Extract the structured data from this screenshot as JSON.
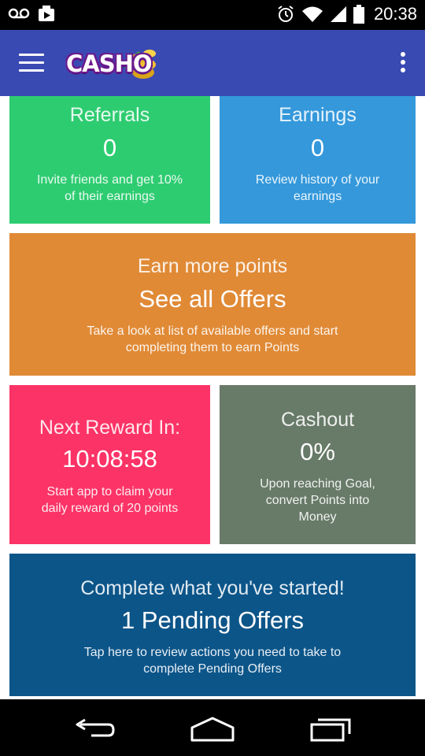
{
  "status_bar": {
    "time": "20:38",
    "left_icons": [
      "voicemail-icon",
      "media-icon"
    ],
    "right_icons": [
      "alarm-icon",
      "wifi-icon",
      "signal-icon",
      "battery-icon"
    ]
  },
  "app_bar": {
    "logo_text": "CASHO",
    "background": "#3a4ab3",
    "icons": [
      "menu-icon",
      "overflow-menu-icon"
    ]
  },
  "tiles": {
    "referrals": {
      "title": "Referrals",
      "value": "0",
      "description_line1": "Invite friends and get 10%",
      "description_line2": "of their earnings",
      "color": "#2ecc71"
    },
    "earnings": {
      "title": "Earnings",
      "value": "0",
      "description_line1": "Review history of your",
      "description_line2": "earnings",
      "color": "#3498db"
    },
    "offers": {
      "title": "Earn more points",
      "headline": "See all Offers",
      "description_line1": "Take a look at list of available offers and start",
      "description_line2": "completing them to earn Points",
      "color": "#e08a36"
    },
    "reward": {
      "title": "Next Reward In:",
      "countdown": "10:08:58",
      "description_line1": "Start app to claim your",
      "description_line2": "daily reward of 20 points",
      "color": "#fc3366"
    },
    "cashout": {
      "title": "Cashout",
      "value": "0%",
      "description_line1": "Upon reaching Goal,",
      "description_line2": "convert Points into",
      "description_line3": "Money",
      "color": "#687a68"
    },
    "pending": {
      "title": "Complete what you've started!",
      "headline": "1 Pending Offers",
      "description_line1": "Tap here to review actions you need to take to",
      "description_line2": "complete Pending Offers",
      "color": "#0c5589"
    }
  },
  "nav_bar": {
    "buttons": [
      "back-icon",
      "home-icon",
      "recents-icon"
    ]
  }
}
